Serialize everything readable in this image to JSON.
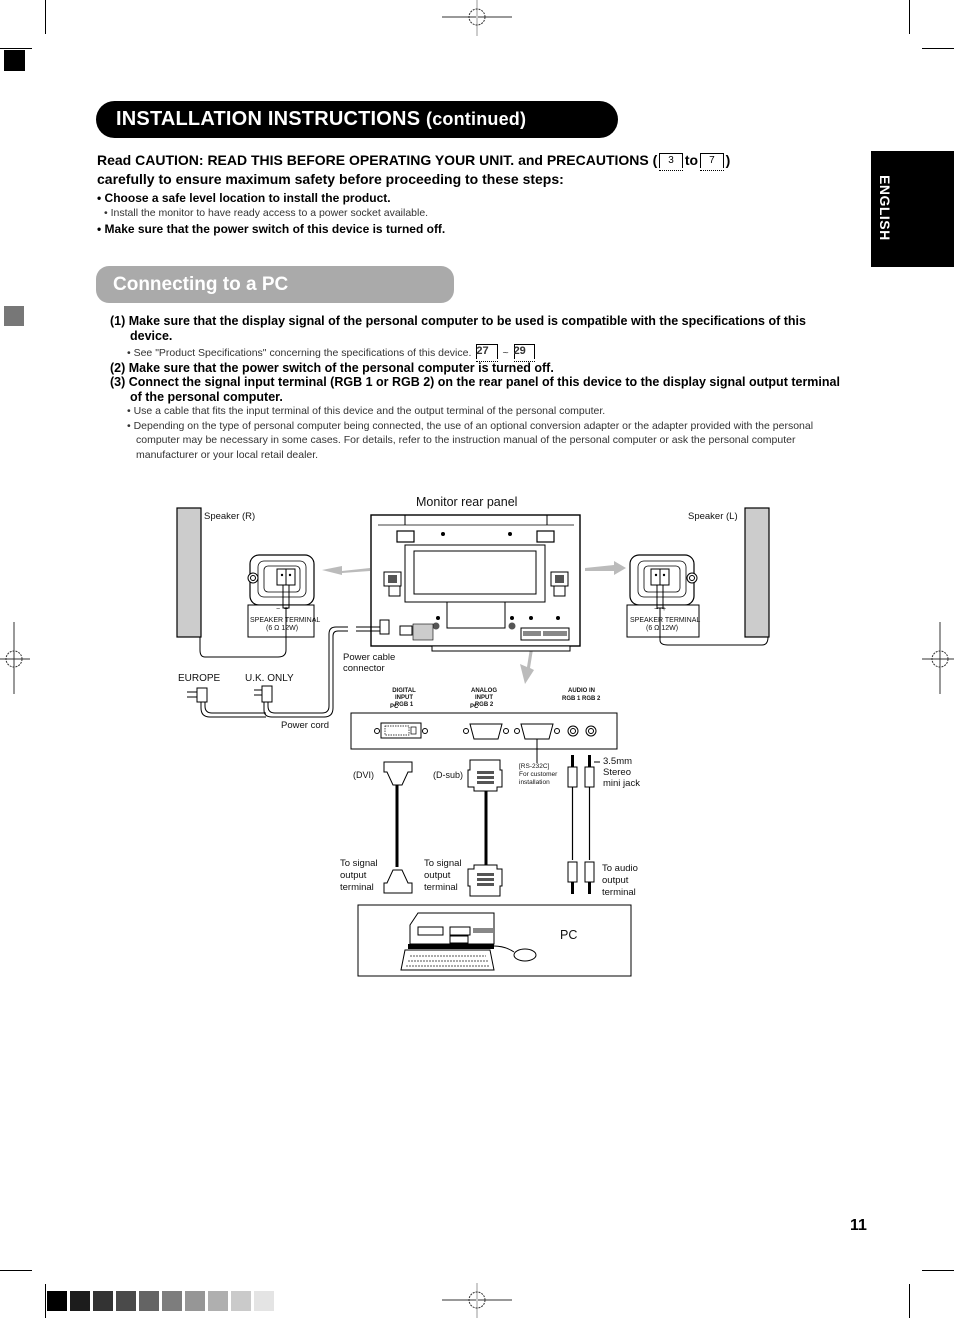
{
  "header": {
    "title": "INSTALLATION INSTRUCTIONS",
    "title_suffix": "(continued)"
  },
  "side_tab": {
    "label": "ENGLISH"
  },
  "intro": {
    "line1_a": "Read CAUTION: READ THIS BEFORE OPERATING YOUR UNIT. and PRECAUTIONS (",
    "line1_page_from": "3",
    "line1_to": "to",
    "line1_page_to": "7",
    "line1_end": ")",
    "line2": "carefully to ensure maximum safety before proceeding to these steps:",
    "bullets": [
      {
        "text": "• Choose a safe level location to install the product.",
        "level": 1
      },
      {
        "text": "• Install the monitor to have ready access to a power socket available.",
        "level": 2
      },
      {
        "text": "• Make sure that the power switch of this device is turned off.",
        "level": 1
      }
    ]
  },
  "section": {
    "title": "Connecting to a PC"
  },
  "steps": [
    {
      "text": "(1) Make sure that the display signal of the personal computer to be used is compatible with the specifications of this device."
    },
    {
      "sub": "• See \"Product Specifications\" concerning the specifications of this device.",
      "page_from": "27",
      "sep": "~",
      "page_to": "29"
    },
    {
      "text": "(2) Make sure that the power switch of the personal computer is turned off."
    },
    {
      "text": "(3) Connect the signal input terminal (RGB 1 or RGB 2) on the rear panel of this device to the display signal output terminal of the personal computer."
    },
    {
      "sub": "• Use a cable that fits the input terminal of this device and the output terminal of the personal computer."
    },
    {
      "sub": "• Depending on the type of personal computer being connected, the use of an optional conversion adapter or the adapter provided with the personal computer may be necessary in some cases. For details, refer to the instruction manual of the personal computer or ask the personal computer manufacturer or your local retail dealer."
    }
  ],
  "diagram": {
    "monitor_rear_panel": "Monitor rear panel",
    "speaker_r": "Speaker (R)",
    "speaker_l": "Speaker (L)",
    "speaker_terminal": "SPEAKER TERMINAL",
    "speaker_terminal_spec": "(6 Ω 12W)",
    "minus": "−",
    "plus": "+",
    "power_cable_connector_1": "Power cable",
    "power_cable_connector_2": "connector",
    "europe": "EUROPE",
    "uk_only": "U.K. ONLY",
    "power_cord": "Power cord",
    "digital_input": "DIGITAL INPUT",
    "digital_input_rgb": "RGB 1",
    "analog_input": "ANALOG INPUT",
    "analog_input_rgb": "RGB 2",
    "audio_in": "AUDIO IN",
    "audio_rgb1": "RGB 1",
    "audio_rgb2": "RGB 2",
    "pc_mark": "PC",
    "dvi": "(DVI)",
    "dsub": "(D-sub)",
    "rs232c_1": "[RS-232C]",
    "rs232c_2": "For customer",
    "rs232c_3": "installation",
    "stereo_1": "3.5mm",
    "stereo_2": "Stereo",
    "stereo_3": "mini jack",
    "to_signal_1": "To signal",
    "to_signal_2": "output",
    "to_signal_3": "terminal",
    "to_audio_1": "To audio",
    "to_audio_2": "output",
    "to_audio_3": "terminal",
    "pc": "PC"
  },
  "footer": {
    "page_number": "11",
    "swatches": [
      "#000000",
      "#1c1c1c",
      "#333333",
      "#4a4a4a",
      "#646464",
      "#7d7d7d",
      "#969696",
      "#afafaf",
      "#cacaca",
      "#e4e4e4"
    ]
  }
}
